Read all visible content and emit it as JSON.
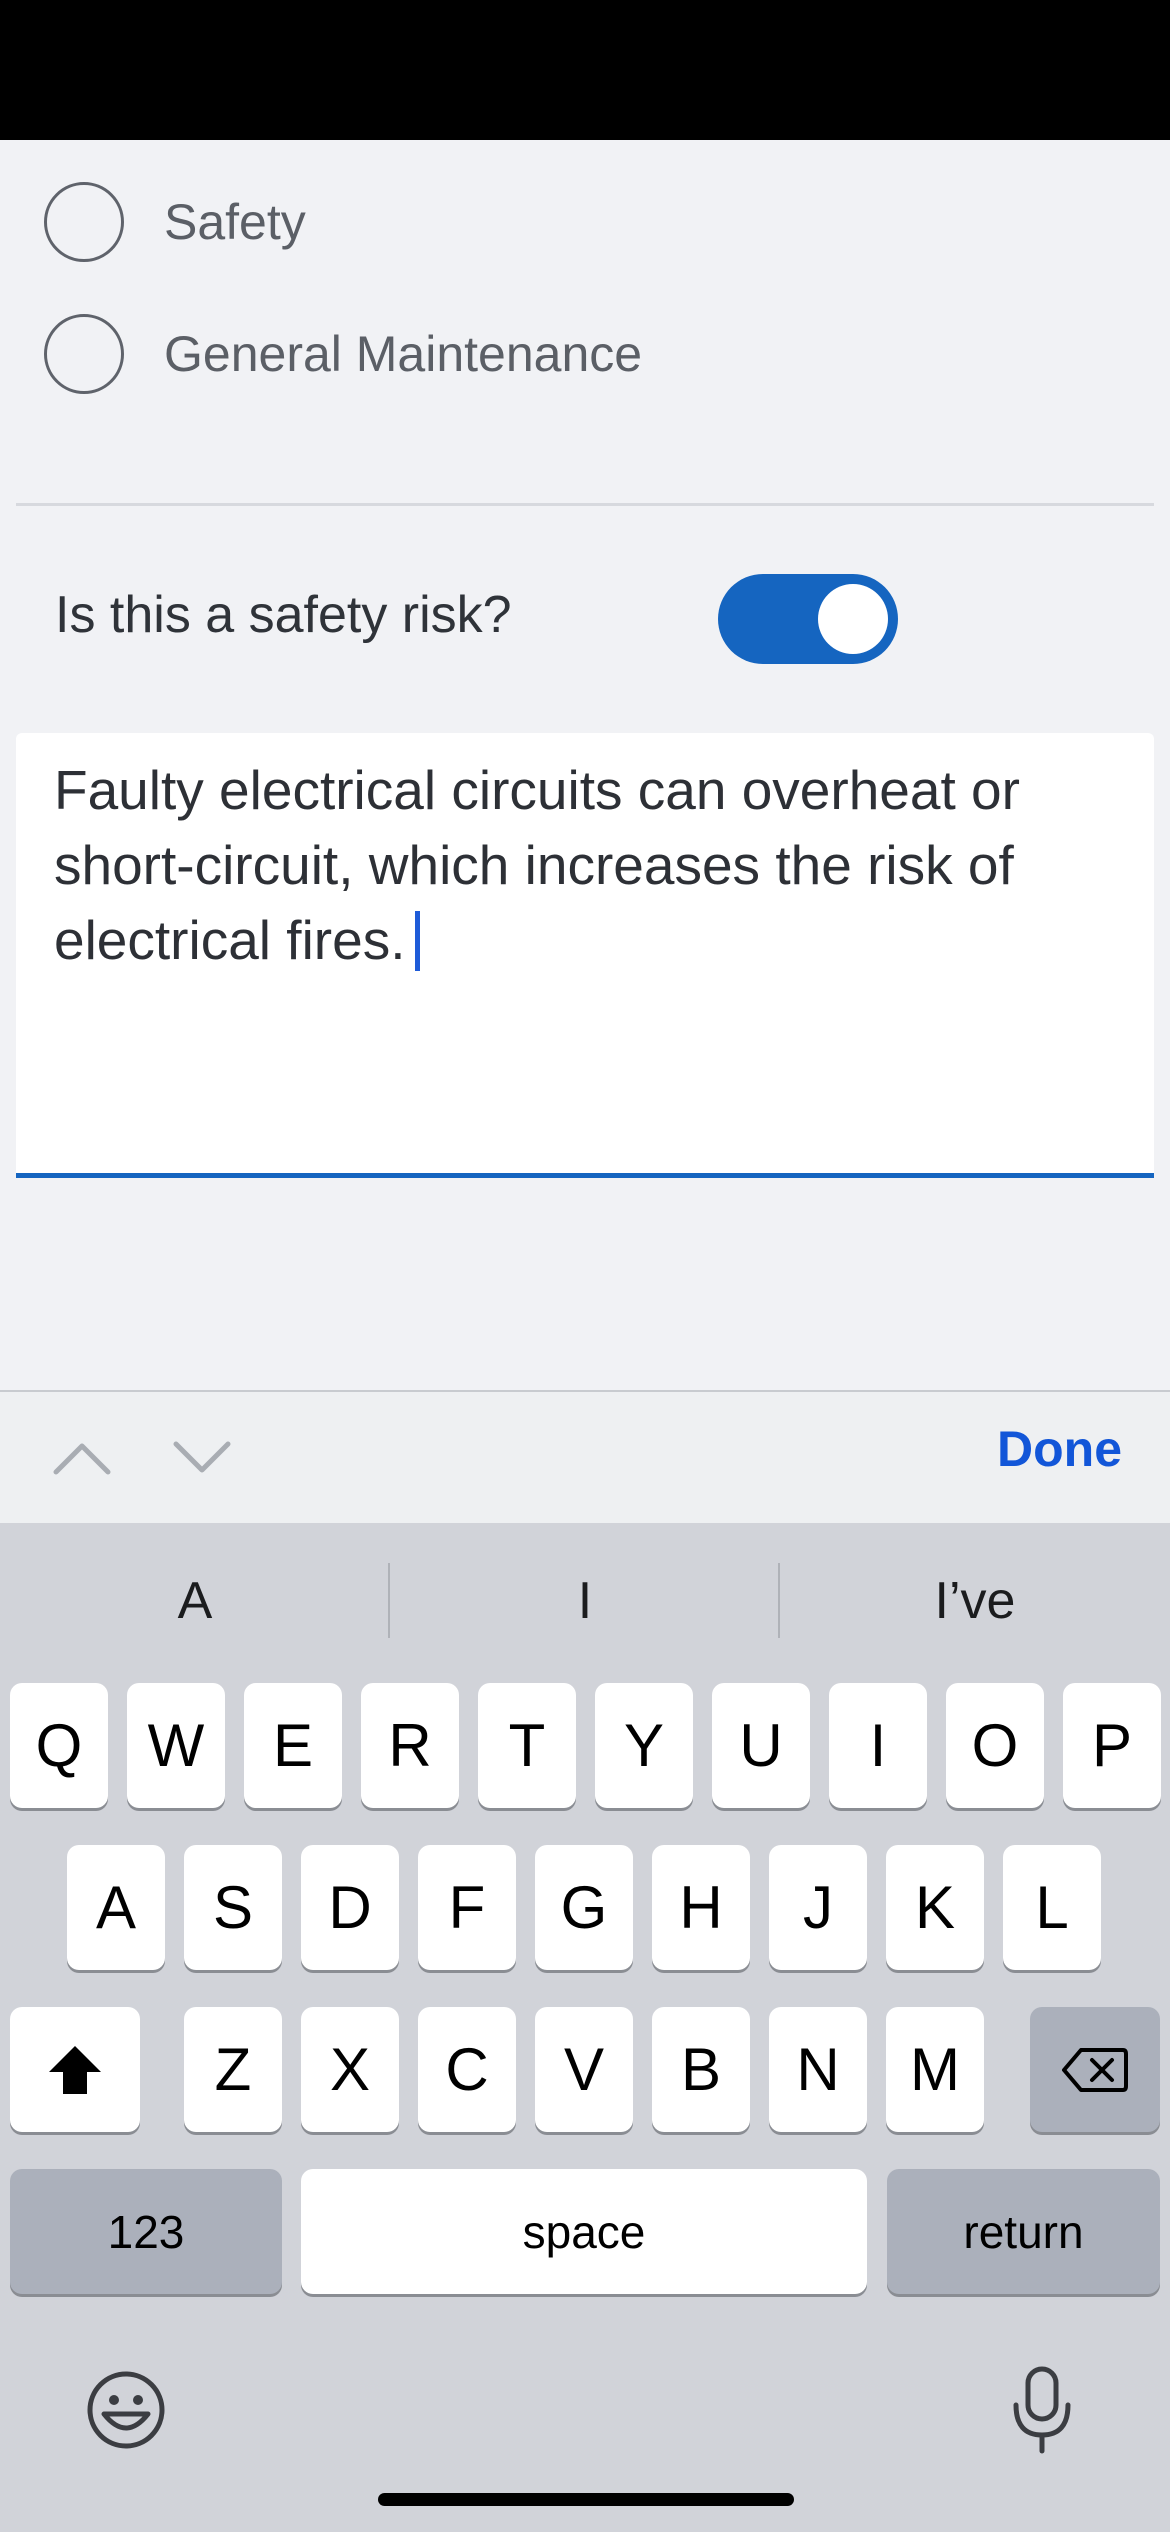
{
  "form": {
    "options": [
      {
        "label": "Safety",
        "selected": false
      },
      {
        "label": "General Maintenance",
        "selected": false
      }
    ],
    "safety_question": "Is this a safety risk?",
    "safety_toggle_on": true,
    "description": "Faulty electrical circuits can overheat or short-circuit, which increases the risk of electrical fires."
  },
  "accessory": {
    "up_icon": "chevron-up-icon",
    "down_icon": "chevron-down-icon",
    "done_label": "Done"
  },
  "keyboard": {
    "suggestions": [
      "A",
      "I",
      "I’ve"
    ],
    "row1": [
      "Q",
      "W",
      "E",
      "R",
      "T",
      "Y",
      "U",
      "I",
      "O",
      "P"
    ],
    "row2": [
      "A",
      "S",
      "D",
      "F",
      "G",
      "H",
      "J",
      "K",
      "L"
    ],
    "row3": [
      "Z",
      "X",
      "C",
      "V",
      "B",
      "N",
      "M"
    ],
    "numbers_label": "123",
    "space_label": "space",
    "return_label": "return",
    "shift_icon": "shift-icon",
    "delete_icon": "delete-icon",
    "emoji_icon": "emoji-icon",
    "mic_icon": "microphone-icon"
  },
  "colors": {
    "accent": "#1565c0",
    "done": "#1256d8",
    "keyboard_bg": "#d1d3d9"
  }
}
